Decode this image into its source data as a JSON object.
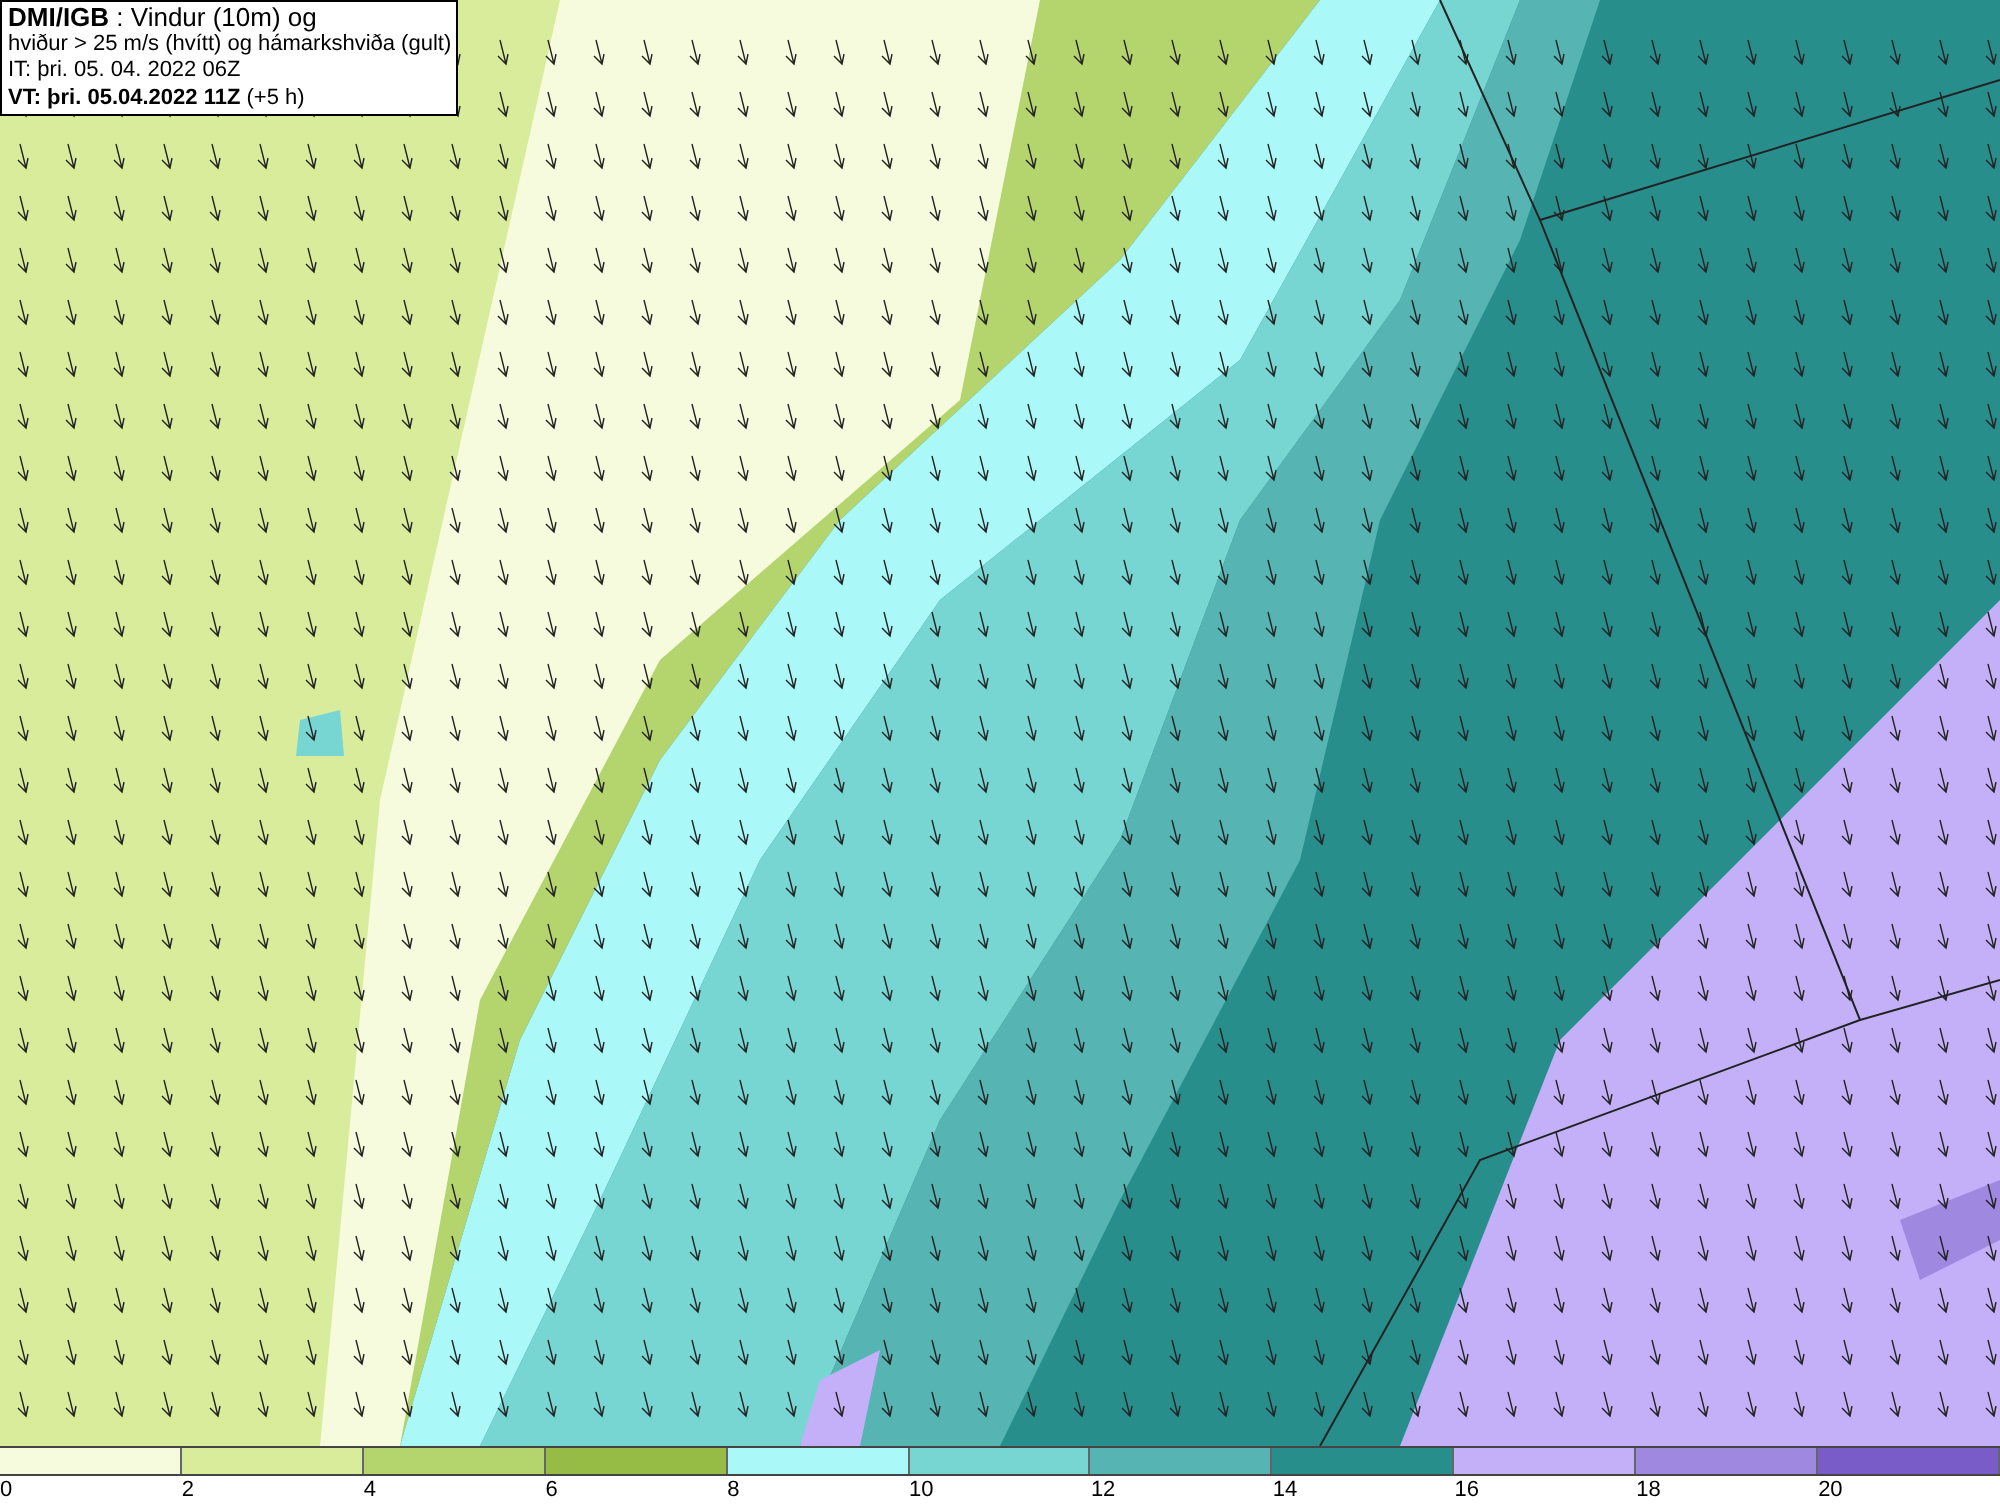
{
  "info_box": {
    "lines": [
      "**DMI/IGB** : Vindur (10m) og",
      "hviður > 25 m/s (hvítt) og hámarkshviða (gult)",
      "IT: þri. 05. 04. 2022 06Z",
      "**VT: þri. 05.04.2022 11Z** (+5 h)"
    ]
  },
  "legend": {
    "bins": [
      {
        "color": "#f5fbdc"
      },
      {
        "color": "#d8ec9c"
      },
      {
        "color": "#b4d46e"
      },
      {
        "color": "#96bc46"
      },
      {
        "color": "#aaf8f8"
      },
      {
        "color": "#78d6d2"
      },
      {
        "color": "#56b4b2"
      },
      {
        "color": "#288e8c"
      },
      {
        "color": "#c4b0f8"
      },
      {
        "color": "#9e88e0"
      },
      {
        "color": "#7a5cc8"
      }
    ],
    "ticks": [
      "0",
      "2",
      "4",
      "6",
      "8",
      "10",
      "12",
      "14",
      "16",
      "18",
      "20"
    ]
  }
}
